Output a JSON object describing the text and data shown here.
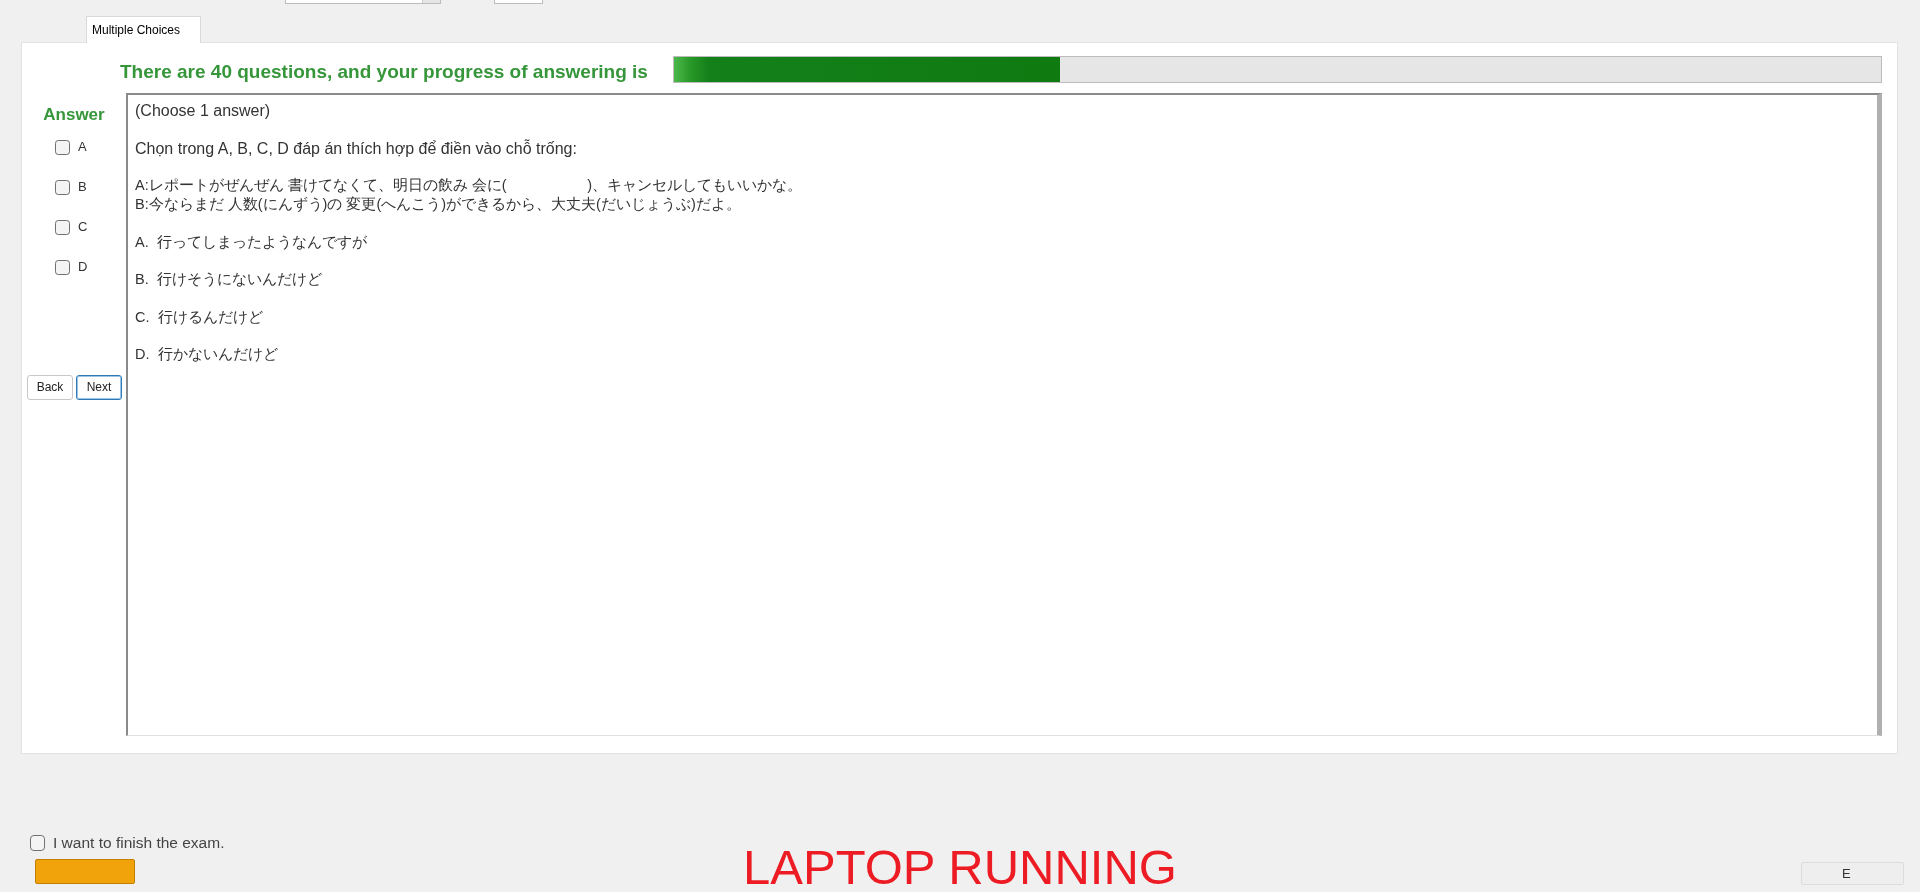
{
  "tabs": [
    {
      "label": "Multiple Choices",
      "selected": true
    }
  ],
  "progress": {
    "label": "There are 40 questions, and your progress of answering is",
    "level": 0.32
  },
  "answer_panel": {
    "title": "Answer",
    "options": [
      {
        "label": "A",
        "checked": false
      },
      {
        "label": "B",
        "checked": false
      },
      {
        "label": "C",
        "checked": false
      },
      {
        "label": "D",
        "checked": false
      }
    ]
  },
  "navigation": [
    {
      "label": "Back",
      "focused": false
    },
    {
      "label": "Next",
      "focused": true
    }
  ],
  "question": {
    "instruction": "(Choose 1 answer)",
    "prompt": "Chọn trong A, B, C, D đáp án thích hợp để điền vào chỗ trống:",
    "dialogue": [
      "A:レポートがぜんぜん 書けてなくて、明日の飲み 会に(                    )、キャンセルしてもいいかな。",
      "B:今ならまだ 人数(にんずう)の 変更(へんこう)ができるから、大丈夫(だいじょうぶ)だよ。"
    ],
    "choices": [
      "A.  行ってしまったようなんですが",
      "B.  行けそうにないんだけど",
      "C.  行けるんだけど",
      "D.  行かないんだけど"
    ]
  },
  "finish": {
    "label": "I want to finish the exam.",
    "checked": false
  },
  "status_text": "LAPTOP RUNNING",
  "corner_button": {
    "label": "E"
  }
}
